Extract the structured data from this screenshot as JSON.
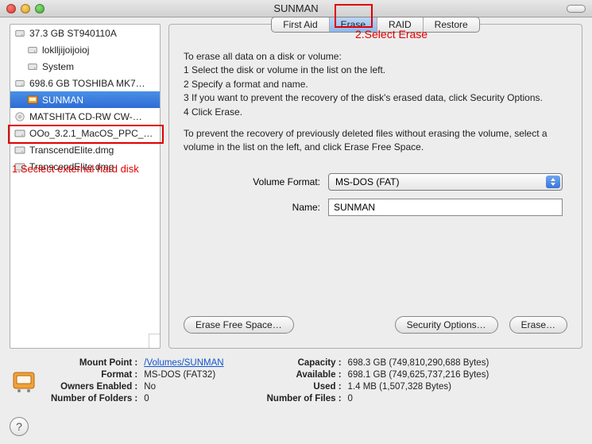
{
  "window": {
    "title": "SUNMAN"
  },
  "annotations": {
    "step1": "1.Seclect external hard disk",
    "step2": "2.Select Erase"
  },
  "sidebar": {
    "items": [
      {
        "label": "37.3 GB ST940110A",
        "type": "drive",
        "level": 0
      },
      {
        "label": "loklljijoijoioj",
        "type": "drive",
        "level": 1
      },
      {
        "label": "System",
        "type": "drive",
        "level": 1
      },
      {
        "label": "698.6 GB TOSHIBA MK7…",
        "type": "drive",
        "level": 0
      },
      {
        "label": "SUNMAN",
        "type": "usb",
        "level": 1,
        "selected": true
      },
      {
        "label": "MATSHITA CD-RW CW-…",
        "type": "cd",
        "level": 0
      },
      {
        "label": "OOo_3.2.1_MacOS_PPC_…",
        "type": "dmg",
        "level": 0
      },
      {
        "label": "TranscendElite.dmg",
        "type": "dmg",
        "level": 0
      },
      {
        "label": "TranscendElite.dmg",
        "type": "dmg",
        "level": 0
      }
    ]
  },
  "tabs": {
    "items": [
      "First Aid",
      "Erase",
      "RAID",
      "Restore"
    ],
    "active": 1
  },
  "instructions": {
    "intro": "To erase all data on a disk or volume:",
    "steps": [
      "1  Select the disk or volume in the list on the left.",
      "2  Specify a format and name.",
      "3  If you want to prevent the recovery of the disk's erased data, click Security Options.",
      "4  Click Erase."
    ],
    "note": "To prevent the recovery of previously deleted files without erasing the volume, select a volume in the list on the left, and click Erase Free Space."
  },
  "form": {
    "volume_format_label": "Volume Format:",
    "volume_format_value": "MS-DOS (FAT)",
    "name_label": "Name:",
    "name_value": "SUNMAN"
  },
  "buttons": {
    "erase_free_space": "Erase Free Space…",
    "security_options": "Security Options…",
    "erase": "Erase…"
  },
  "footer": {
    "left": {
      "mount_point_label": "Mount Point :",
      "mount_point_value": "/Volumes/SUNMAN",
      "format_label": "Format :",
      "format_value": "MS-DOS (FAT32)",
      "owners_enabled_label": "Owners Enabled :",
      "owners_enabled_value": "No",
      "num_folders_label": "Number of Folders :",
      "num_folders_value": "0"
    },
    "right": {
      "capacity_label": "Capacity :",
      "capacity_value": "698.3 GB (749,810,290,688 Bytes)",
      "available_label": "Available :",
      "available_value": "698.1 GB (749,625,737,216 Bytes)",
      "used_label": "Used :",
      "used_value": "1.4 MB (1,507,328 Bytes)",
      "num_files_label": "Number of Files :",
      "num_files_value": "0"
    }
  },
  "help": "?"
}
